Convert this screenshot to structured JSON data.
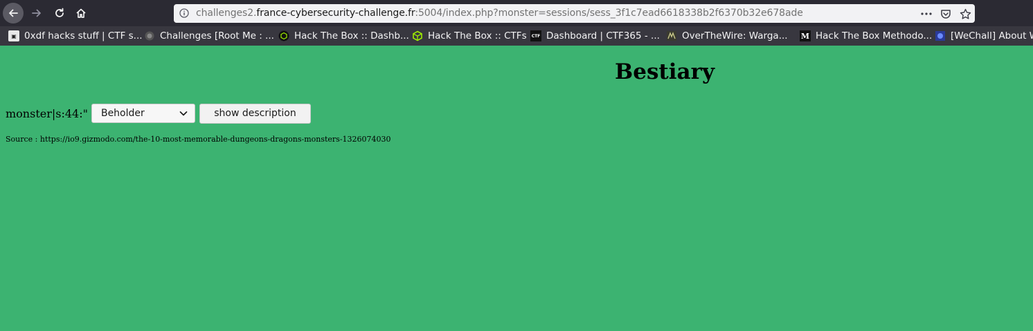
{
  "browser": {
    "url_prefix": "challenges2.",
    "url_host": "france-cybersecurity-challenge.fr",
    "url_suffix": ":5004/index.php?monster=sessions/sess_3f1c7ead6618338b2f6370b32e678ade",
    "icons": [
      "back-arrow-icon",
      "forward-arrow-icon",
      "reload-icon",
      "home-icon",
      "info-icon",
      "more-dots-icon",
      "pocket-icon",
      "star-icon"
    ]
  },
  "bookmarks": [
    {
      "label": "0xdf hacks stuff | CTF s...",
      "icon": "0xdf-favicon"
    },
    {
      "label": "Challenges [Root Me : ...",
      "icon": "rootme-favicon"
    },
    {
      "label": "Hack The Box :: Dashb...",
      "icon": "htb-favicon"
    },
    {
      "label": "Hack The Box :: CTFs",
      "icon": "htb-ctf-favicon"
    },
    {
      "label": "Dashboard | CTF365 - ...",
      "icon": "ctf365-favicon"
    },
    {
      "label": "OverTheWire: Warga...",
      "icon": "overthewire-favicon"
    },
    {
      "label": "Hack The Box Methodo...",
      "icon": "medium-favicon"
    },
    {
      "label": "[WeChall] About W",
      "icon": "wechall-favicon"
    }
  ],
  "page": {
    "title": "Bestiary",
    "label": "monster|s:44:\"",
    "select_value": "Beholder",
    "button_label": "show description",
    "source_text": "Source : https://io9.gizmodo.com/the-10-most-memorable-dungeons-dragons-monsters-1326074030",
    "background_color": "#3cb371"
  }
}
